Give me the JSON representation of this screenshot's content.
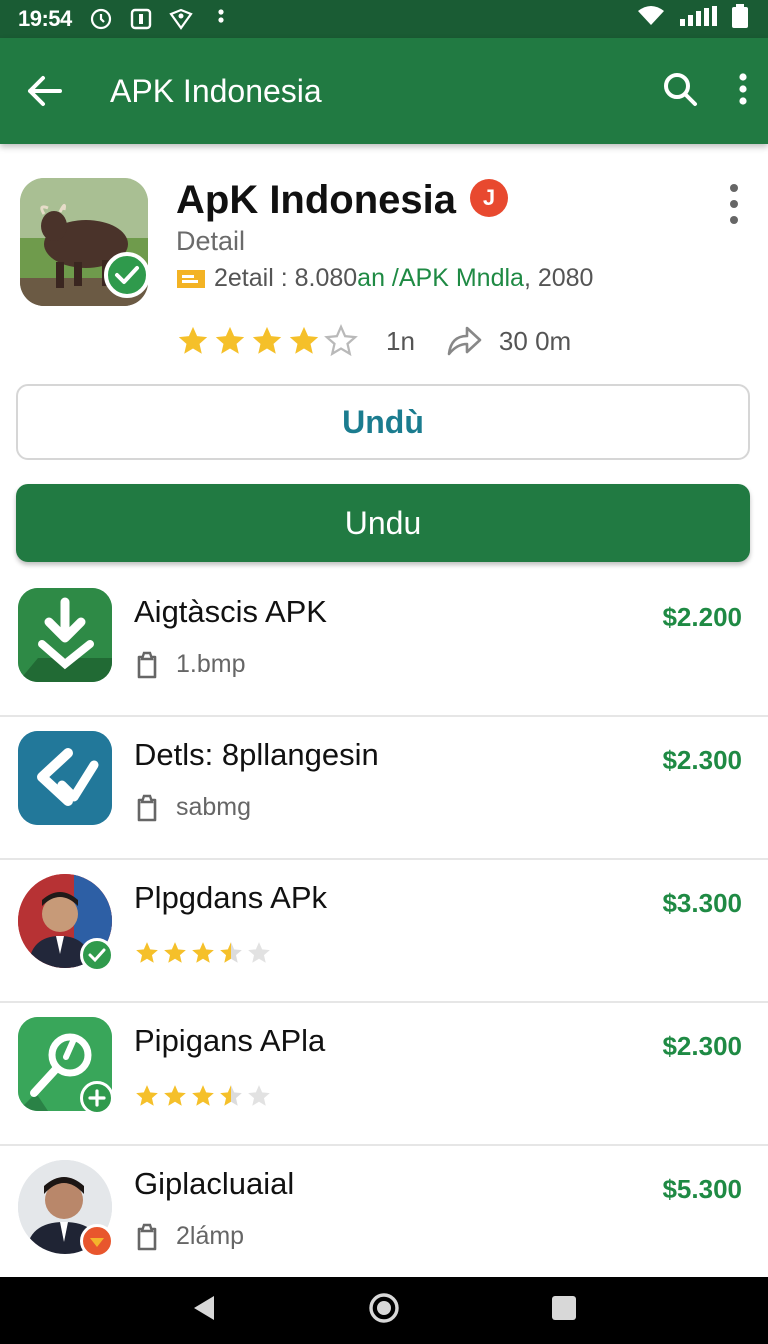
{
  "status_bar": {
    "time": "19:54"
  },
  "app_bar": {
    "title": "APK Indonesia"
  },
  "header": {
    "app_name": "ApK Indonesia",
    "badge_letter": "J",
    "subtitle": "Detail",
    "meta_prefix": "2etail : 8.080 ",
    "meta_green": "an /APK Mndla",
    "meta_suffix": ", 2080",
    "rating": 4,
    "rating_count": "1n",
    "downloads": "30  0m",
    "button_outline": "Undù",
    "button_fill": "Undu"
  },
  "list": [
    {
      "name": "Aigtàscis APK",
      "sub": "1.bmp",
      "price": "$2.200"
    },
    {
      "name": "Detls: 8pllangesin",
      "sub": "sabmg",
      "price": "$2.300"
    },
    {
      "name": "Plpgdans APk",
      "stars": 3.5,
      "price": "$3.300"
    },
    {
      "name": "Pipigans APla",
      "stars": 3.5,
      "price": "$2.300"
    },
    {
      "name": "Giplacluaial",
      "sub": "2lámp",
      "price": "$5.300"
    }
  ],
  "colors": {
    "primary": "#217a42",
    "status_bar": "#1a5c34",
    "price_green": "#1f8a44",
    "outline_text": "#1b7c8f",
    "star": "#f5c02a"
  }
}
